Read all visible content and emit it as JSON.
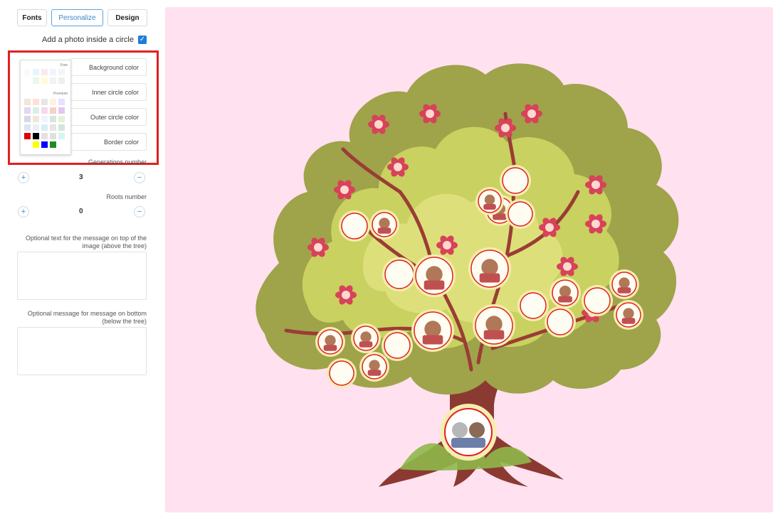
{
  "tabs": [
    {
      "label": "Fonts"
    },
    {
      "label": "Personalize"
    },
    {
      "label": "Design"
    }
  ],
  "photo_toggle": {
    "label": "Add a photo inside a circle",
    "checked": true
  },
  "palette": {
    "free_label": "Free",
    "premium_label": "Premium"
  },
  "color_rows": [
    {
      "label": "Background color"
    },
    {
      "label": "Inner circle color"
    },
    {
      "label": "Outer circle color"
    },
    {
      "label": "Border color"
    }
  ],
  "generations": {
    "label": "Generations number",
    "value": "3",
    "plus": "+",
    "minus": "−"
  },
  "roots": {
    "label": "Roots number",
    "value": "0",
    "plus": "+",
    "minus": "−"
  },
  "top_message": {
    "label": "Optional text for the message on top of the image (above the tree)",
    "value": ""
  },
  "bottom_message": {
    "label": "Optional message for message on bottom (below the tree)",
    "value": ""
  },
  "canvas": {
    "background": "#ffe1ef"
  },
  "colors": {
    "accent": "#3a86c8",
    "highlight": "#e02020"
  }
}
